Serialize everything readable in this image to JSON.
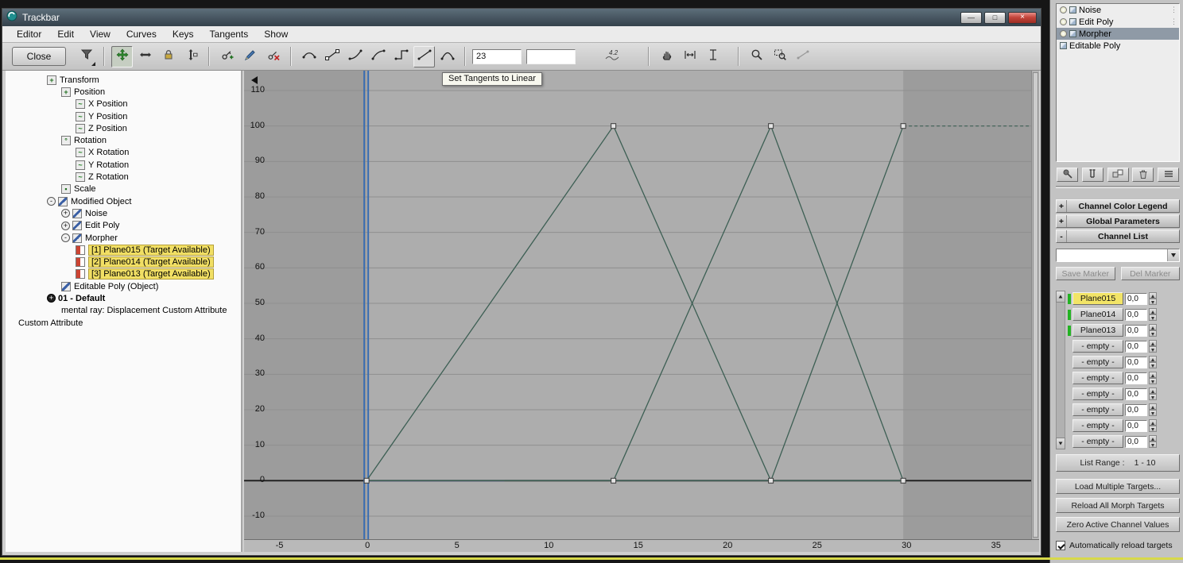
{
  "window": {
    "title": "Trackbar",
    "minimize": "—",
    "maximize": "□",
    "close": "×"
  },
  "menu": {
    "items": [
      "Editor",
      "Edit",
      "View",
      "Curves",
      "Keys",
      "Tangents",
      "Show"
    ]
  },
  "toolbar": {
    "close": "Close",
    "key_time": "23",
    "key_value": "",
    "tooltip": "Set Tangents to Linear",
    "key_stats": "4.2",
    "icons": [
      "filter-icon",
      "move-keys-icon",
      "move-keys-horizontal-icon",
      "slide-keys-icon",
      "scale-keys-icon",
      "add-keys-icon",
      "draw-curves-icon",
      "delete-keys-icon",
      "set-tangents-auto-icon",
      "set-tangents-custom-icon",
      "set-tangents-fast-icon",
      "set-tangents-slow-icon",
      "set-tangents-step-icon",
      "set-tangents-linear-icon",
      "set-tangents-smooth-icon",
      "show-key-stats-icon",
      "pan-icon",
      "fit-horizontal-extents-icon",
      "fit-value-extents-icon",
      "zoom-icon",
      "zoom-region-icon",
      "zoom-selected-icon"
    ]
  },
  "tree": {
    "items": [
      {
        "label": "Transform",
        "level": 3,
        "icon": "transform"
      },
      {
        "label": "Position",
        "level": 4,
        "icon": "position"
      },
      {
        "label": "X Position",
        "level": 5,
        "icon": "curve"
      },
      {
        "label": "Y Position",
        "level": 5,
        "icon": "curve"
      },
      {
        "label": "Z Position",
        "level": 5,
        "icon": "curve"
      },
      {
        "label": "Rotation",
        "level": 4,
        "icon": "rotation"
      },
      {
        "label": "X Rotation",
        "level": 5,
        "icon": "curve"
      },
      {
        "label": "Y Rotation",
        "level": 5,
        "icon": "curve"
      },
      {
        "label": "Z Rotation",
        "level": 5,
        "icon": "curve"
      },
      {
        "label": "Scale",
        "level": 4,
        "icon": "scale"
      },
      {
        "label": "Modified Object",
        "level": 3,
        "expander": "-",
        "icon": "wrench"
      },
      {
        "label": "Noise",
        "level": 4,
        "expander": "+",
        "icon": "wrench"
      },
      {
        "label": "Edit Poly",
        "level": 4,
        "expander": "+",
        "icon": "wrench"
      },
      {
        "label": "Morpher",
        "level": 4,
        "expander": "-",
        "icon": "wrench"
      },
      {
        "label": "[1] Plane015  (Target Available)",
        "level": 5,
        "icon": "channel",
        "hl": true
      },
      {
        "label": "[2] Plane014  (Target Available)",
        "level": 5,
        "icon": "channel",
        "hl": true
      },
      {
        "label": "[3] Plane013  (Target Available)",
        "level": 5,
        "icon": "channel",
        "hl": true
      },
      {
        "label": "Editable Poly (Object)",
        "level": 4,
        "icon": "wrench"
      },
      {
        "label": "01 - Default",
        "level": 3,
        "expander": "+",
        "dark": true,
        "bold": true
      },
      {
        "label": "mental ray: Displacement Custom Attribute",
        "level": 4
      },
      {
        "label": "Custom Attribute",
        "level": 1
      }
    ]
  },
  "chart_data": {
    "type": "line",
    "title": "Morpher channel animation curves",
    "x_ticks": [
      -5,
      0,
      5,
      10,
      15,
      20,
      25,
      30,
      35
    ],
    "y_ticks": [
      -10,
      0,
      10,
      20,
      30,
      40,
      50,
      60,
      70,
      80,
      90,
      100,
      110
    ],
    "x_view": [
      -6.85,
      37.15
    ],
    "y_view": [
      -16.5,
      115.6
    ],
    "active_range": [
      0,
      30
    ],
    "time_cursor": 0,
    "baseline": {
      "value": 0
    },
    "selected_segment": {
      "x1": 0,
      "x2": 7.7,
      "value": 0
    },
    "series": [
      {
        "name": "Plane015",
        "points": [
          [
            0,
            0
          ],
          [
            13.8,
            100
          ],
          [
            22.6,
            0
          ],
          [
            30,
            0
          ]
        ]
      },
      {
        "name": "Plane014",
        "points": [
          [
            0,
            0
          ],
          [
            13.8,
            0
          ],
          [
            22.6,
            100
          ],
          [
            30,
            0
          ]
        ]
      },
      {
        "name": "Plane013",
        "points": [
          [
            0,
            0
          ],
          [
            13.8,
            0
          ],
          [
            22.6,
            0
          ],
          [
            30,
            100
          ]
        ],
        "post_infinity": "constant-dashed"
      }
    ],
    "keys": [
      [
        0,
        0
      ],
      [
        13.8,
        0
      ],
      [
        13.8,
        100
      ],
      [
        22.6,
        0
      ],
      [
        22.6,
        100
      ],
      [
        30,
        0
      ],
      [
        30,
        100
      ]
    ],
    "colors": {
      "out_bg": "#9c9c9c",
      "in_bg": "#adadad",
      "grid": "#8f8f8f",
      "baseline": "#1c1c1c",
      "cursor": "#3a6db0",
      "curve": "#3d5f54",
      "key_fill": "#e4e4e4",
      "key_stroke": "#3a3a3a",
      "selected": "#5a50c8"
    },
    "legend": "none",
    "grid": "horizontal"
  },
  "stack": {
    "items": [
      {
        "label": "Noise",
        "bulb": true,
        "box": true,
        "grip": true
      },
      {
        "label": "Edit Poly",
        "bulb": true,
        "box": true,
        "grip": true
      },
      {
        "label": "Morpher",
        "bulb": true,
        "box": true,
        "selected": true
      },
      {
        "label": "Editable Poly",
        "bulb": false,
        "box": true
      }
    ]
  },
  "stack_tools": [
    "pin-stack",
    "show-end-result",
    "make-unique",
    "remove-modifier",
    "configure-modifier-sets"
  ],
  "rollouts": [
    {
      "label": "Channel Color Legend",
      "state": "+"
    },
    {
      "label": "Global Parameters",
      "state": "+"
    },
    {
      "label": "Channel List",
      "state": "-"
    }
  ],
  "channel_list": {
    "marker_dropdown_value": "",
    "save_marker": "Save Marker",
    "del_marker": "Del Marker",
    "channels": [
      {
        "name": "Plane015",
        "value": "0,0",
        "indicator": true,
        "active": true
      },
      {
        "name": "Plane014",
        "value": "0,0",
        "indicator": true
      },
      {
        "name": "Plane013",
        "value": "0,0",
        "indicator": true
      },
      {
        "name": "- empty -",
        "value": "0,0"
      },
      {
        "name": "- empty -",
        "value": "0,0"
      },
      {
        "name": "- empty -",
        "value": "0,0"
      },
      {
        "name": "- empty -",
        "value": "0,0"
      },
      {
        "name": "- empty -",
        "value": "0,0"
      },
      {
        "name": "- empty -",
        "value": "0,0"
      },
      {
        "name": "- empty -",
        "value": "0,0"
      }
    ],
    "list_range_label": "List Range :",
    "list_range_value": "1 - 10",
    "buttons": [
      "Load Multiple Targets...",
      "Reload All Morph Targets",
      "Zero Active Channel Values"
    ],
    "auto_reload_label": "Automatically reload targets",
    "auto_reload_checked": true
  }
}
